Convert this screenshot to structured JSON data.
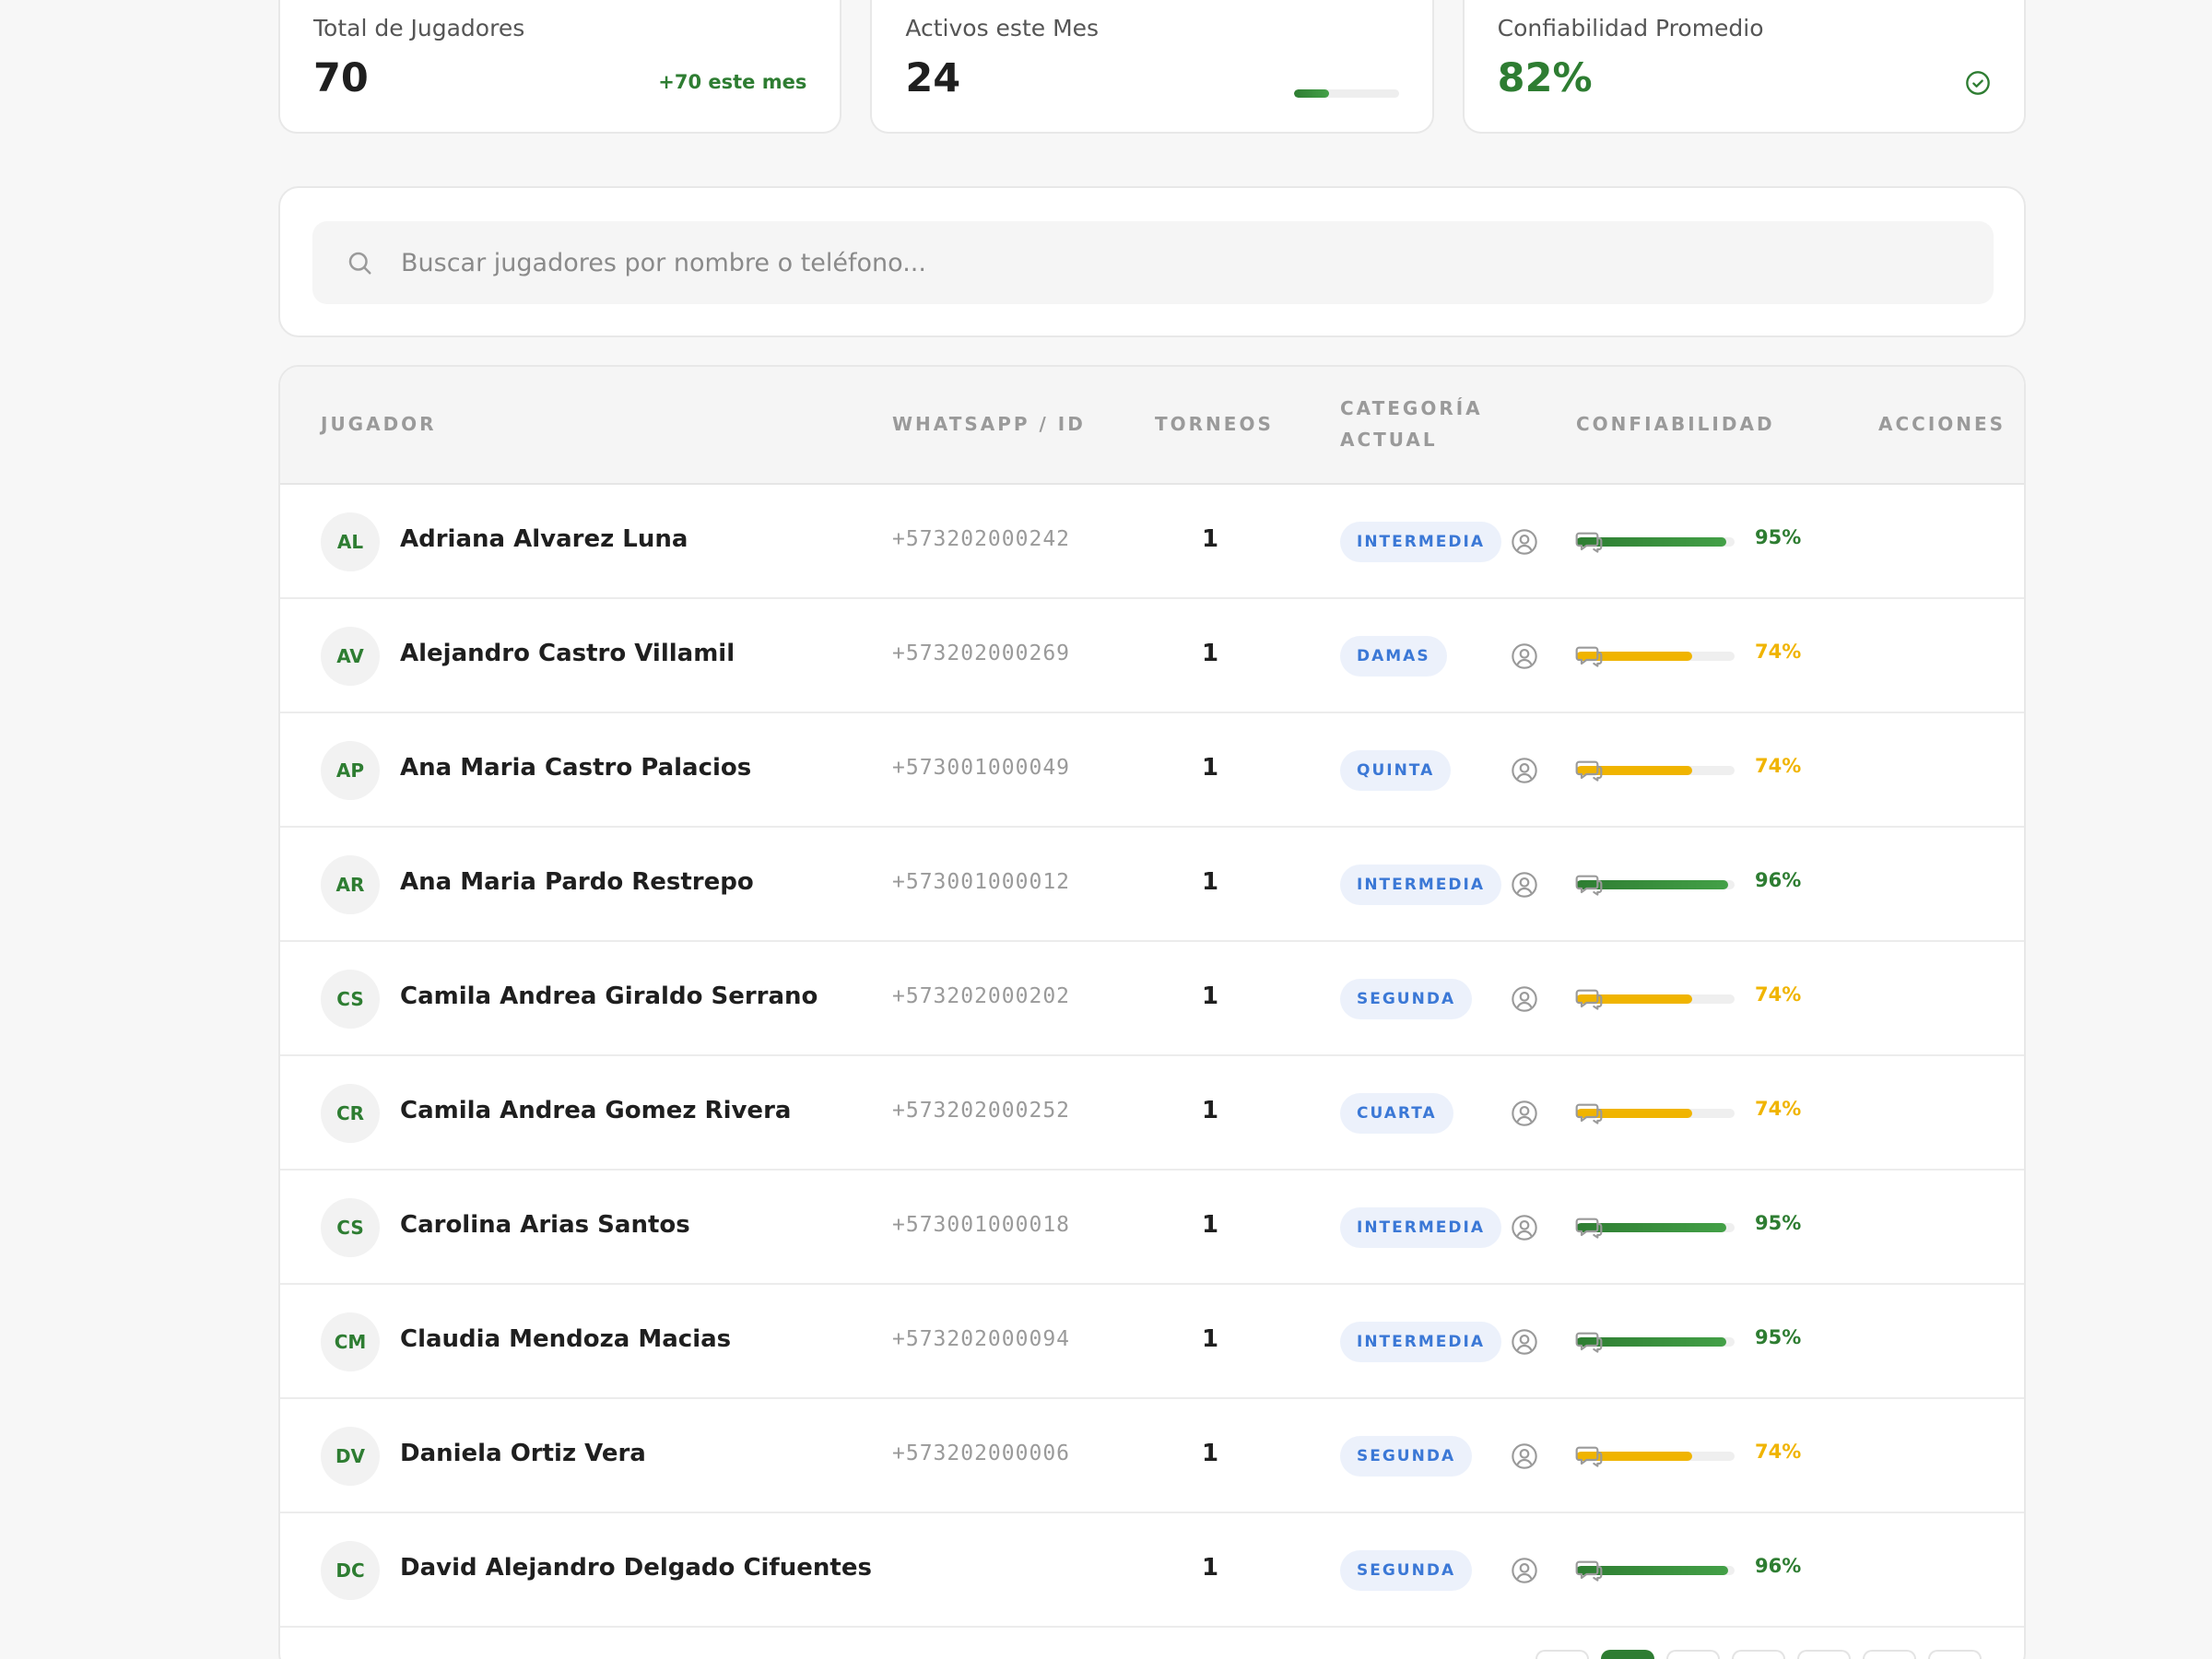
{
  "stats": {
    "total": {
      "label": "Total de Jugadores",
      "value": "70",
      "note": "+70 este mes"
    },
    "active": {
      "label": "Activos este Mes",
      "value": "24",
      "progress_fraction": 0.34
    },
    "reliability": {
      "label": "Confiabilidad Promedio",
      "value": "82%",
      "icon": "check-circle-icon"
    }
  },
  "search": {
    "placeholder": "Buscar jugadores por nombre o teléfono..."
  },
  "table": {
    "headers": {
      "player": "JUGADOR",
      "whatsapp": "WHATSAPP / ID",
      "tournaments": "TORNEOS",
      "category_line1": "CATEGORÍA",
      "category_line2": "ACTUAL",
      "reliability": "CONFIABILIDAD",
      "actions": "ACCIONES"
    },
    "rows": [
      {
        "initials": "AL",
        "name": "Adriana Alvarez Luna",
        "phone": "+573202000242",
        "tournaments": "1",
        "category": "INTERMEDIA",
        "reliability": 95,
        "reliability_label": "95%"
      },
      {
        "initials": "AV",
        "name": "Alejandro Castro Villamil",
        "phone": "+573202000269",
        "tournaments": "1",
        "category": "DAMAS",
        "reliability": 74,
        "reliability_label": "74%"
      },
      {
        "initials": "AP",
        "name": "Ana Maria Castro Palacios",
        "phone": "+573001000049",
        "tournaments": "1",
        "category": "QUINTA",
        "reliability": 74,
        "reliability_label": "74%"
      },
      {
        "initials": "AR",
        "name": "Ana Maria Pardo Restrepo",
        "phone": "+573001000012",
        "tournaments": "1",
        "category": "INTERMEDIA",
        "reliability": 96,
        "reliability_label": "96%"
      },
      {
        "initials": "CS",
        "name": "Camila Andrea Giraldo Serrano",
        "phone": "+573202000202",
        "tournaments": "1",
        "category": "SEGUNDA",
        "reliability": 74,
        "reliability_label": "74%"
      },
      {
        "initials": "CR",
        "name": "Camila Andrea Gomez Rivera",
        "phone": "+573202000252",
        "tournaments": "1",
        "category": "CUARTA",
        "reliability": 74,
        "reliability_label": "74%"
      },
      {
        "initials": "CS",
        "name": "Carolina Arias Santos",
        "phone": "+573001000018",
        "tournaments": "1",
        "category": "INTERMEDIA",
        "reliability": 95,
        "reliability_label": "95%"
      },
      {
        "initials": "CM",
        "name": "Claudia Mendoza Macias",
        "phone": "+573202000094",
        "tournaments": "1",
        "category": "INTERMEDIA",
        "reliability": 95,
        "reliability_label": "95%"
      },
      {
        "initials": "DV",
        "name": "Daniela Ortiz Vera",
        "phone": "+573202000006",
        "tournaments": "1",
        "category": "SEGUNDA",
        "reliability": 74,
        "reliability_label": "74%"
      },
      {
        "initials": "DC",
        "name": "David Alejandro Delgado Cifuentes",
        "phone": "",
        "tournaments": "1",
        "category": "SEGUNDA",
        "reliability": 96,
        "reliability_label": "96%"
      }
    ],
    "action_icons": [
      "user-profile-icon",
      "chat-icon"
    ]
  },
  "colors": {
    "green": "#2e7d32",
    "yellow": "#f0b400",
    "badge_text": "#3b78d6",
    "badge_bg": "#ecf1fb"
  },
  "pagination": {
    "active_index": 0
  }
}
